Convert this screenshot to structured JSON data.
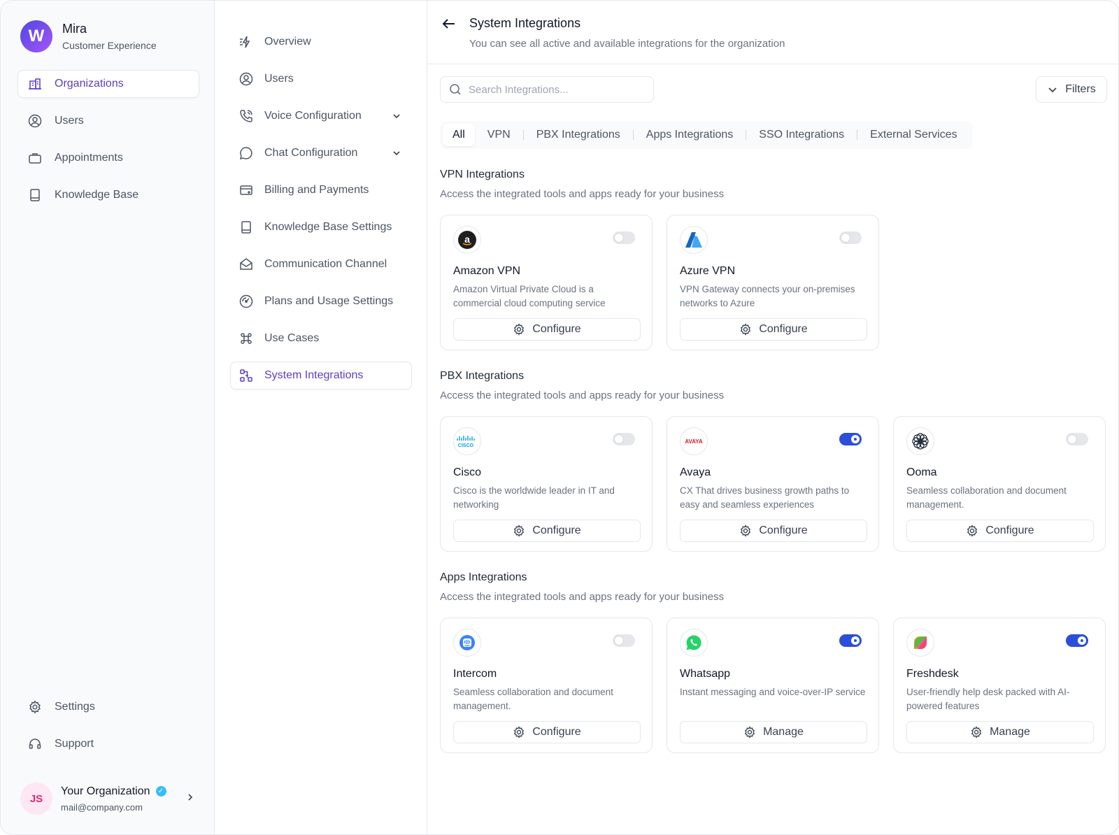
{
  "brand": {
    "name": "Mira",
    "subtitle": "Customer Experience",
    "logo_letter": "W"
  },
  "sidebar": {
    "items": [
      {
        "label": "Organizations",
        "icon": "building-icon",
        "active": true
      },
      {
        "label": "Users",
        "icon": "user-circle-icon"
      },
      {
        "label": "Appointments",
        "icon": "briefcase-icon"
      },
      {
        "label": "Knowledge Base",
        "icon": "book-icon"
      }
    ],
    "bottom_items": [
      {
        "label": "Settings",
        "icon": "gear-icon"
      },
      {
        "label": "Support",
        "icon": "headset-icon"
      }
    ]
  },
  "account": {
    "initials": "JS",
    "name": "Your Organization",
    "email": "mail@company.com"
  },
  "subnav": {
    "items": [
      {
        "label": "Overview",
        "icon": "lightning-icon"
      },
      {
        "label": "Users",
        "icon": "user-circle-icon"
      },
      {
        "label": "Voice Configuration",
        "icon": "phone-icon",
        "expandable": true
      },
      {
        "label": "Chat Configuration",
        "icon": "chat-icon",
        "expandable": true
      },
      {
        "label": "Billing and Payments",
        "icon": "card-icon"
      },
      {
        "label": "Knowledge Base Settings",
        "icon": "book-icon"
      },
      {
        "label": "Communication Channel",
        "icon": "mail-open-icon"
      },
      {
        "label": "Plans and Usage Settings",
        "icon": "gauge-icon"
      },
      {
        "label": "Use Cases",
        "icon": "command-icon"
      },
      {
        "label": "System Integrations",
        "icon": "integrations-icon",
        "active": true
      }
    ]
  },
  "header": {
    "title": "System Integrations",
    "subtitle": "You can see all active and available integrations for the organization"
  },
  "search": {
    "placeholder": "Search Integrations..."
  },
  "filters": {
    "label": "Filters"
  },
  "tabs": [
    "All",
    "VPN",
    "PBX Integrations",
    "Apps Integrations",
    "SSO Integrations",
    "External Services"
  ],
  "sections": [
    {
      "title": "VPN Integrations",
      "subtitle": "Access the integrated tools and apps ready for your business",
      "cards": [
        {
          "name": "Amazon VPN",
          "desc": "Amazon Virtual Private Cloud is a commercial cloud computing service",
          "button": "Configure",
          "enabled": false,
          "logo": "amazon-logo-icon"
        },
        {
          "name": "Azure VPN",
          "desc": "VPN Gateway connects your on-premises networks to Azure",
          "button": "Configure",
          "enabled": false,
          "logo": "azure-logo-icon"
        }
      ]
    },
    {
      "title": "PBX Integrations",
      "subtitle": "Access the integrated tools and apps ready for your business",
      "cards": [
        {
          "name": "Cisco",
          "desc": "Cisco is the worldwide leader in IT and networking",
          "button": "Configure",
          "enabled": false,
          "logo": "cisco-logo-icon",
          "logo_text": "CISCO"
        },
        {
          "name": "Avaya",
          "desc": "CX That drives business growth paths to easy and seamless experiences",
          "button": "Configure",
          "enabled": true,
          "logo": "avaya-logo-icon",
          "logo_text": "AVAYA"
        },
        {
          "name": "Ooma",
          "desc": "Seamless collaboration and document management.",
          "button": "Configure",
          "enabled": false,
          "logo": "ooma-logo-icon"
        }
      ]
    },
    {
      "title": "Apps Integrations",
      "subtitle": "Access the integrated tools and apps ready for your business",
      "cards": [
        {
          "name": "Intercom",
          "desc": "Seamless collaboration and document management.",
          "button": "Configure",
          "enabled": false,
          "logo": "intercom-logo-icon"
        },
        {
          "name": "Whatsapp",
          "desc": "Instant messaging and voice-over-IP service",
          "button": "Manage",
          "enabled": true,
          "logo": "whatsapp-logo-icon"
        },
        {
          "name": "Freshdesk",
          "desc": "User-friendly help desk packed with AI-powered features",
          "button": "Manage",
          "enabled": true,
          "logo": "freshdesk-logo-icon"
        }
      ]
    }
  ],
  "colors": {
    "accent": "#5b3fc4",
    "toggle_on": "#2b4fd8"
  }
}
